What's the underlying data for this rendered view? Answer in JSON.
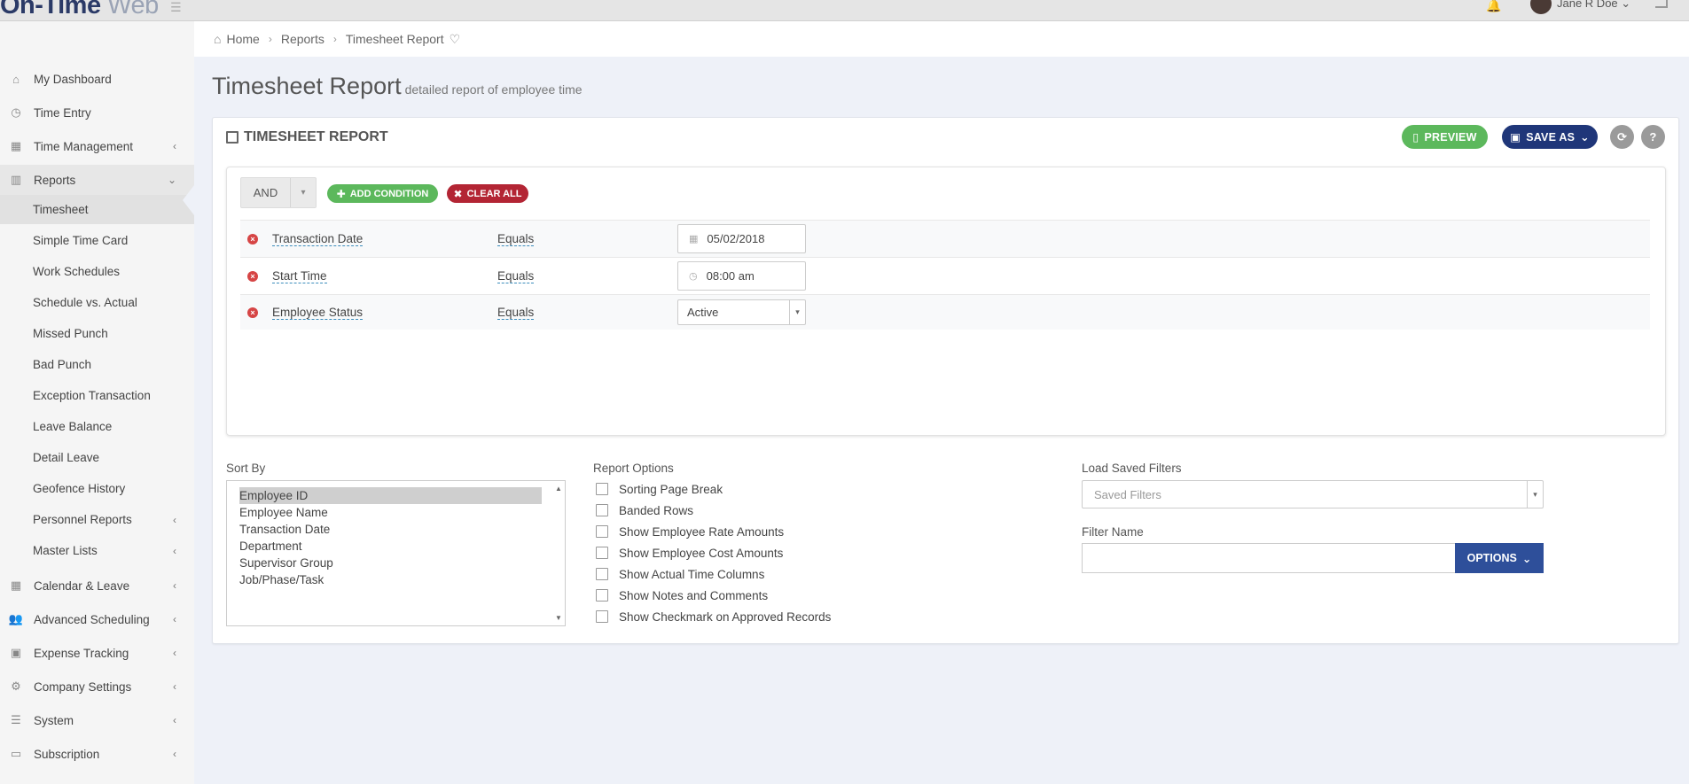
{
  "app": {
    "logo_main": "On-Time",
    "logo_sub": "Web",
    "user_name": "Jane R Doe"
  },
  "icons": {
    "home": "home-icon",
    "clock": "clock-icon",
    "calendar": "calendar-icon",
    "chart": "chart-icon",
    "users": "users-icon",
    "money": "money-icon",
    "gears": "gears-icon",
    "server": "server-icon",
    "card": "credit-card-icon"
  },
  "sidebar": {
    "items": [
      {
        "label": "My Dashboard"
      },
      {
        "label": "Time Entry"
      },
      {
        "label": "Time Management"
      },
      {
        "label": "Reports"
      }
    ],
    "report_items": [
      {
        "label": "Timesheet"
      },
      {
        "label": "Simple Time Card"
      },
      {
        "label": "Work Schedules"
      },
      {
        "label": "Schedule vs. Actual"
      },
      {
        "label": "Missed Punch"
      },
      {
        "label": "Bad Punch"
      },
      {
        "label": "Exception Transaction"
      },
      {
        "label": "Leave Balance"
      },
      {
        "label": "Detail Leave"
      },
      {
        "label": "Geofence History"
      },
      {
        "label": "Personnel Reports"
      },
      {
        "label": "Master Lists"
      }
    ],
    "bottom_items": [
      {
        "label": "Calendar & Leave"
      },
      {
        "label": "Advanced Scheduling"
      },
      {
        "label": "Expense Tracking"
      },
      {
        "label": "Company Settings"
      },
      {
        "label": "System"
      },
      {
        "label": "Subscription"
      }
    ]
  },
  "breadcrumb": {
    "home": "Home",
    "reports": "Reports",
    "current": "Timesheet Report"
  },
  "page": {
    "title": "Timesheet Report",
    "subtitle": "detailed report of employee time"
  },
  "card": {
    "title": "TIMESHEET REPORT",
    "preview_label": "PREVIEW",
    "saveas_label": "SAVE AS",
    "refresh_label": "⟳",
    "help_label": "?"
  },
  "filters": {
    "logic": "AND",
    "add_label": "ADD CONDITION",
    "clear_label": "CLEAR ALL",
    "conditions": [
      {
        "field": "Transaction Date",
        "operator": "Equals",
        "value": "05/02/2018"
      },
      {
        "field": "Start Time",
        "operator": "Equals",
        "value": "08:00 am"
      },
      {
        "field": "Employee Status",
        "operator": "Equals",
        "value": "Active"
      }
    ]
  },
  "sort_by": {
    "label": "Sort By",
    "options": [
      "Employee ID",
      "Employee Name",
      "Transaction Date",
      "Department",
      "Supervisor Group",
      "Job/Phase/Task"
    ],
    "selected": "Employee ID"
  },
  "report_options": {
    "label": "Report Options",
    "items": [
      "Sorting Page Break",
      "Banded Rows",
      "Show Employee Rate Amounts",
      "Show Employee Cost Amounts",
      "Show Actual Time Columns",
      "Show Notes and Comments",
      "Show Checkmark on Approved Records"
    ]
  },
  "saved_filters": {
    "label": "Load Saved Filters",
    "placeholder": "Saved Filters",
    "filter_name_label": "Filter Name",
    "filter_name_value": "",
    "options_label": "OPTIONS"
  },
  "colors": {
    "green": "#5cb85c",
    "navy": "#1f3679",
    "red": "#b32534",
    "blue": "#2e4f9a"
  }
}
